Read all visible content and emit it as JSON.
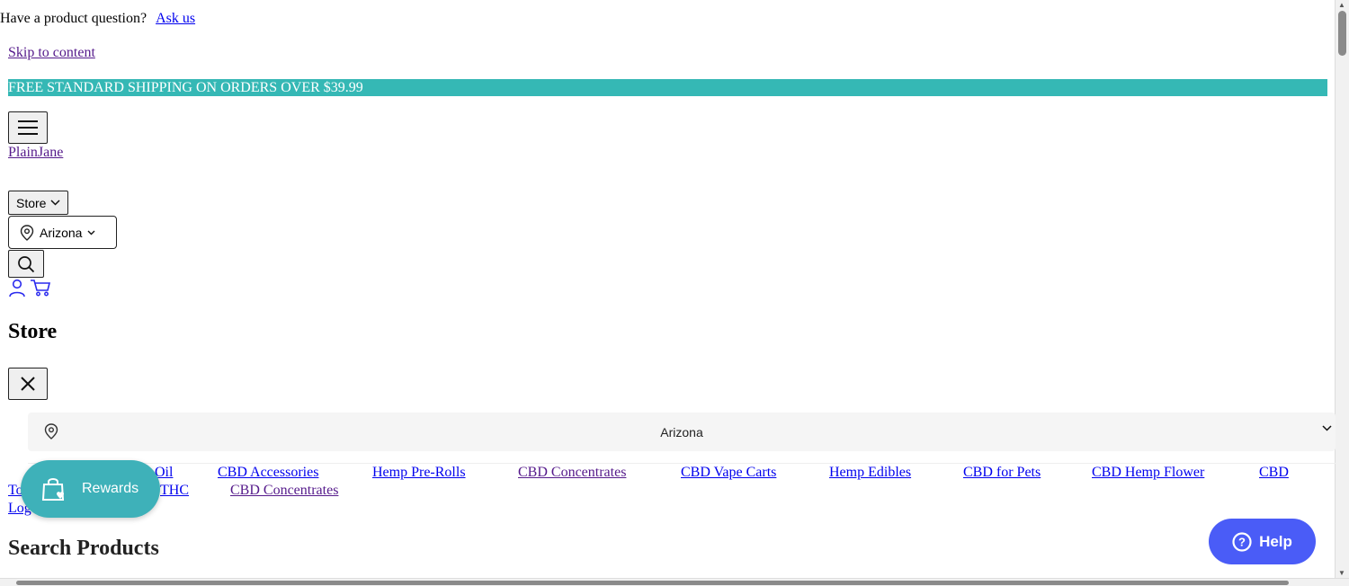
{
  "announcement": {
    "question": "Have a product question?",
    "ask_link": "Ask us"
  },
  "skip_link": "Skip to content",
  "banner": {
    "text": "FREE STANDARD SHIPPING ON ORDERS OVER $39.99",
    "color": "#35b8b5"
  },
  "logo": {
    "alt": "PlainJane"
  },
  "header": {
    "store_button": "Store",
    "location_button": "Arizona"
  },
  "drawer": {
    "title": "Store",
    "location_select_value": "Arizona"
  },
  "nav": {
    "row1": [
      "Oil",
      "CBD Accessories",
      "Hemp Pre-Rolls",
      "CBD Concentrates",
      "CBD Vape Carts",
      "Hemp Edibles",
      "CBD for Pets",
      "CBD Hemp Flower",
      "CBD"
    ],
    "row2": [
      "To",
      "THC",
      "CBD Concentrates"
    ],
    "row3": [
      "Log"
    ]
  },
  "search_title": "Search Products",
  "rewards_widget": {
    "label": "Rewards",
    "color": "#3eb1b9"
  },
  "help_widget": {
    "label": "Help",
    "color": "#4a5cf7"
  }
}
